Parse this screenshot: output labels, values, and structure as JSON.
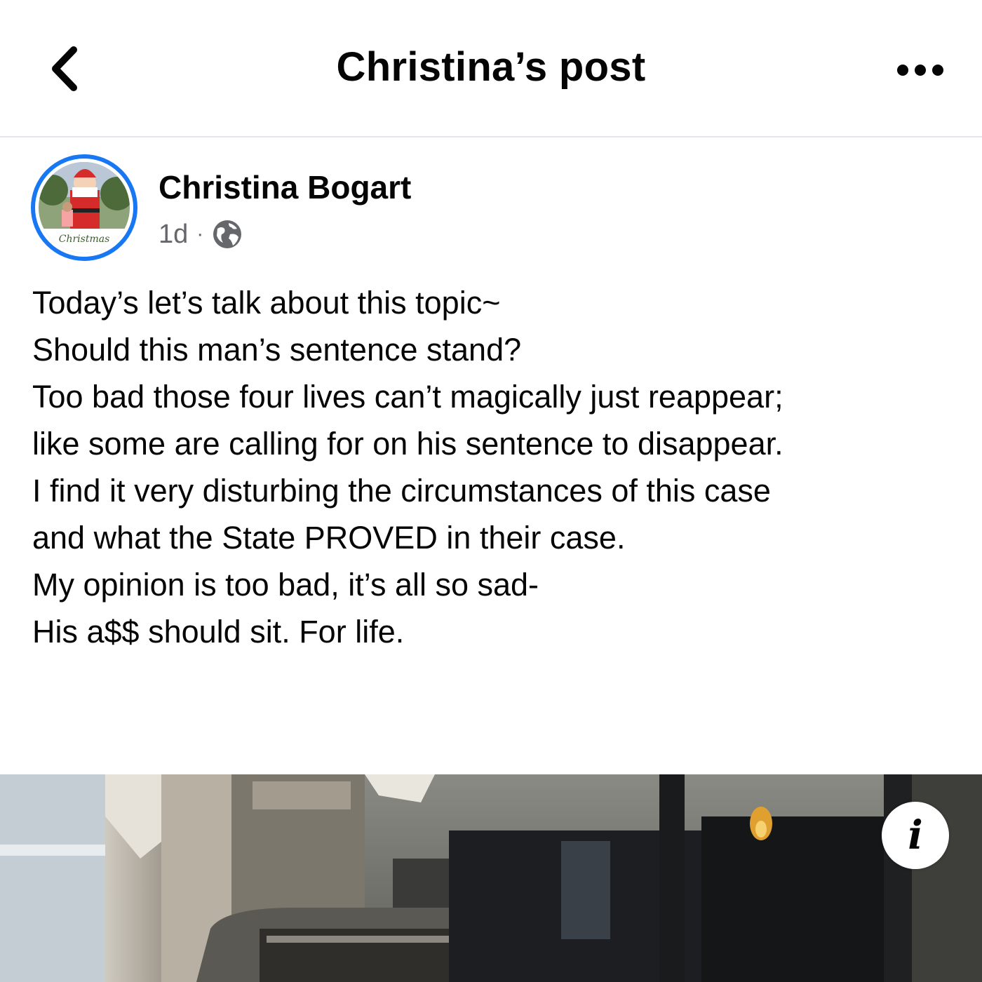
{
  "header": {
    "title": "Christina’s post",
    "back_icon": "chevron-left-icon",
    "more_icon": "more-horizontal-icon"
  },
  "post": {
    "author": "Christina Bogart",
    "avatar_caption": "Christmas",
    "timestamp": "1d",
    "separator": "·",
    "privacy_icon": "globe-icon",
    "paragraphs": [
      "Today’s let’s talk about this topic~",
      "",
      "Should this man’s sentence stand?",
      "",
      "Too bad those four lives can’t magically just reappear;",
      "like some are calling for on his sentence to disappear.",
      "I find it very disturbing the circumstances of this case",
      "and what the State PROVED in their case.",
      "My opinion is too bad, it’s all so sad-",
      "His a$$ should sit. For life."
    ],
    "info_label": "i",
    "accent_color": "#1877f2"
  }
}
